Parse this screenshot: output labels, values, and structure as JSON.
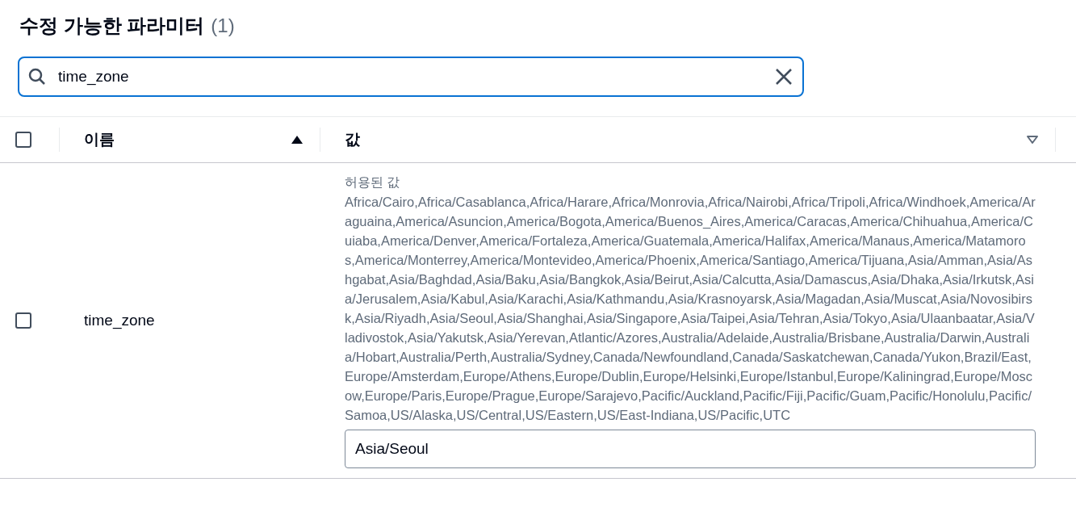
{
  "title": "수정 가능한 파라미터",
  "count": "(1)",
  "search": {
    "value": "time_zone"
  },
  "table": {
    "select_all": {
      "checked": false
    },
    "columns": [
      {
        "label": "이름",
        "sorted": true
      },
      {
        "label": "값",
        "sorted": false
      }
    ],
    "rows": [
      {
        "selected": false,
        "name": "time_zone",
        "allowed_label": "허용된 값",
        "allowed_values": "Africa/Cairo,Africa/Casablanca,Africa/Harare,Africa/Monrovia,Africa/Nairobi,Africa/Tripoli,Africa/Windhoek,America/Araguaina,America/Asuncion,America/Bogota,America/Buenos_Aires,America/Caracas,America/Chihuahua,America/Cuiaba,America/Denver,America/Fortaleza,America/Guatemala,America/Halifax,America/Manaus,America/Matamoros,America/Monterrey,America/Montevideo,America/Phoenix,America/Santiago,America/Tijuana,Asia/Amman,Asia/Ashgabat,Asia/Baghdad,Asia/Baku,Asia/Bangkok,Asia/Beirut,Asia/Calcutta,Asia/Damascus,Asia/Dhaka,Asia/Irkutsk,Asia/Jerusalem,Asia/Kabul,Asia/Karachi,Asia/Kathmandu,Asia/Krasnoyarsk,Asia/Magadan,Asia/Muscat,Asia/Novosibirsk,Asia/Riyadh,Asia/Seoul,Asia/Shanghai,Asia/Singapore,Asia/Taipei,Asia/Tehran,Asia/Tokyo,Asia/Ulaanbaatar,Asia/Vladivostok,Asia/Yakutsk,Asia/Yerevan,Atlantic/Azores,Australia/Adelaide,Australia/Brisbane,Australia/Darwin,Australia/Hobart,Australia/Perth,Australia/Sydney,Canada/Newfoundland,Canada/Saskatchewan,Canada/Yukon,Brazil/East,Europe/Amsterdam,Europe/Athens,Europe/Dublin,Europe/Helsinki,Europe/Istanbul,Europe/Kaliningrad,Europe/Moscow,Europe/Paris,Europe/Prague,Europe/Sarajevo,Pacific/Auckland,Pacific/Fiji,Pacific/Guam,Pacific/Honolulu,Pacific/Samoa,US/Alaska,US/Central,US/Eastern,US/East-Indiana,US/Pacific,UTC",
        "value": "Asia/Seoul"
      }
    ]
  }
}
